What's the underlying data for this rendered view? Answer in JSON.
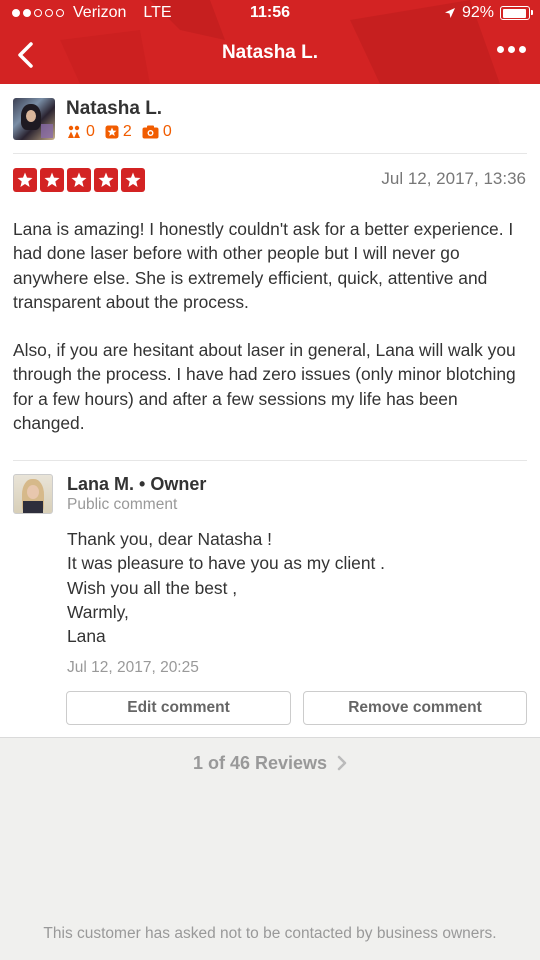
{
  "status_bar": {
    "carrier": "Verizon",
    "network": "LTE",
    "time": "11:56",
    "battery": "92%",
    "battery_level": 0.92,
    "signal_bars_filled": 2,
    "signal_bars_total": 5
  },
  "nav": {
    "title": "Natasha L.",
    "back_icon": "chevron-left-icon",
    "more_icon": "more-horizontal-icon"
  },
  "reviewer": {
    "name": "Natasha L.",
    "friends": "0",
    "reviews": "2",
    "photos": "0",
    "friends_icon": "friends-icon",
    "reviews_icon": "review-star-icon",
    "photos_icon": "camera-icon"
  },
  "review": {
    "rating": 5,
    "date": "Jul 12, 2017, 13:36",
    "paragraphs": [
      "Lana is amazing! I honestly couldn't ask for a better experience. I had done laser before with other people but I will never go anywhere else. She is extremely efficient, quick, attentive and transparent about the process.",
      "Also, if you are hesitant about laser in general, Lana will walk you through the process. I have had zero issues (only minor blotching for a few hours) and after a few sessions my life has been changed."
    ]
  },
  "comment": {
    "owner_name": "Lana M.",
    "owner_role": "Owner",
    "type": "Public comment",
    "lines": [
      "Thank you, dear Natasha !",
      "It was pleasure to have you as my client .",
      "Wish you all the best ,",
      "Warmly,",
      "Lana"
    ],
    "date": "Jul 12, 2017, 20:25",
    "edit_label": "Edit comment",
    "remove_label": "Remove comment"
  },
  "pager": {
    "label": "1 of 46 Reviews",
    "next_icon": "chevron-right-icon"
  },
  "footer_note": "This customer has asked not to be contacted by business owners.",
  "colors": {
    "brand_red": "#d32323",
    "stat_orange": "#f15c00",
    "muted_gray": "#999999",
    "background": "#f0f0ee"
  }
}
